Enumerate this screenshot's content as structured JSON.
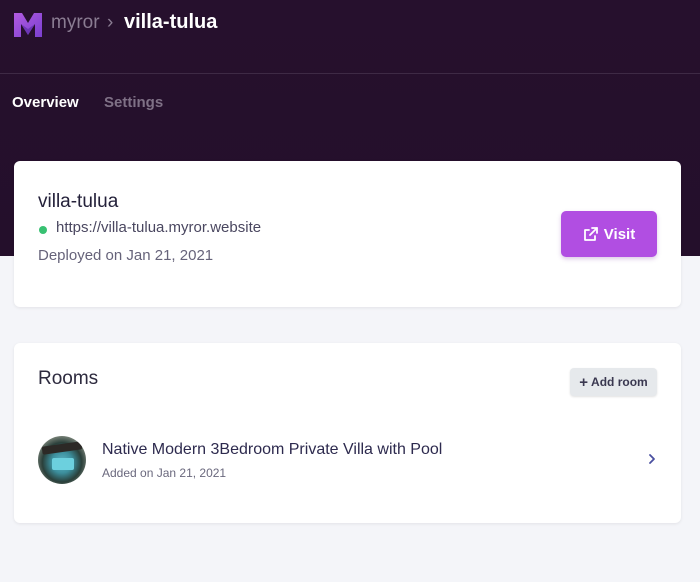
{
  "header": {
    "brand": "myror",
    "separator": "›",
    "project": "villa-tulua"
  },
  "tabs": [
    {
      "label": "Overview",
      "active": true
    },
    {
      "label": "Settings",
      "active": false
    }
  ],
  "site": {
    "name": "villa-tulua",
    "url": "https://villa-tulua.myror.website",
    "status_color": "#38c172",
    "deployed": "Deployed on Jan 21, 2021",
    "visit_label": "Visit"
  },
  "rooms": {
    "title": "Rooms",
    "add_label": "Add room",
    "items": [
      {
        "name": "Native Modern 3Bedroom Private Villa with Pool",
        "added": "Added on Jan 21, 2021"
      }
    ]
  },
  "colors": {
    "header_bg": "#26102d",
    "accent": "#b14ee2",
    "page_bg": "#f4f5f9"
  }
}
